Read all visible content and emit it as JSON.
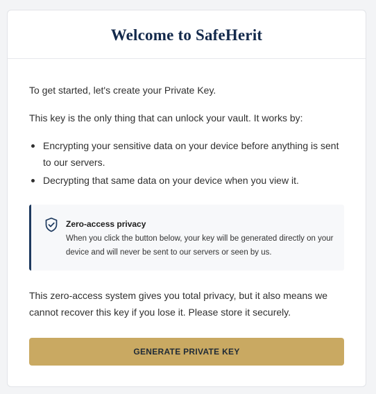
{
  "header": {
    "title": "Welcome to SafeHerit"
  },
  "body": {
    "intro": "To get started, let's create your Private Key.",
    "lead": "This key is the only thing that can unlock your vault. It works by:",
    "bullets": [
      "Encrypting your sensitive data on your device before anything is sent to our servers.",
      "Decrypting that same data on your device when you view it."
    ],
    "callout": {
      "icon": "shield-check-icon",
      "title": "Zero-access privacy",
      "text": "When you click the button below, your key will be generated directly on your device and will never be sent to our servers or seen by us."
    },
    "outro": "This zero-access system gives you total privacy, but it also means we cannot recover this key if you lose it. Please store it securely."
  },
  "actions": {
    "generate_label": "GENERATE PRIVATE KEY"
  },
  "colors": {
    "title": "#13294b",
    "accent_border": "#1e3a5f",
    "button_bg": "#c9a962",
    "callout_bg": "#f7f8fa"
  }
}
